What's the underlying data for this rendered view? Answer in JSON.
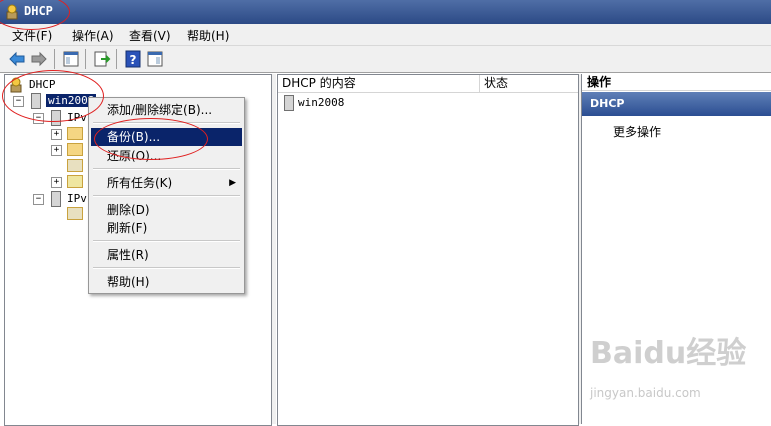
{
  "window": {
    "title": "DHCP"
  },
  "menubar": [
    {
      "label": "文件(F)"
    },
    {
      "label": "操作(A)"
    },
    {
      "label": "查看(V)"
    },
    {
      "label": "帮助(H)"
    }
  ],
  "toolbar": {
    "buttons": [
      "back-arrow-icon",
      "forward-arrow-icon",
      "show-hide-tree-icon",
      "export-list-icon",
      "help-icon",
      "properties-icon"
    ]
  },
  "tree": {
    "root": "DHCP",
    "server": "win2008",
    "ipv4_partial": "IPv",
    "ipv6_partial": "IPv"
  },
  "content": {
    "headers": [
      "DHCP 的内容",
      "状态"
    ],
    "rows": [
      {
        "name": "win2008",
        "status": ""
      }
    ]
  },
  "context_menu": {
    "items": [
      {
        "label": "添加/删除绑定(B)..."
      },
      {
        "label": "备份(B)..."
      },
      {
        "label": "还原(O)..."
      },
      {
        "label": "所有任务(K)"
      },
      {
        "label": "删除(D)"
      },
      {
        "label": "刷新(F)"
      },
      {
        "label": "属性(R)"
      },
      {
        "label": "帮助(H)"
      }
    ],
    "highlighted": "备份(B)..."
  },
  "actions": {
    "header": "操作",
    "group": "DHCP",
    "items": [
      "更多操作"
    ]
  },
  "watermark": {
    "brand": "Baidu经验",
    "url": "jingyan.baidu.com"
  },
  "colors": {
    "title_bar": "#2c4a86",
    "highlight": "#0a246a",
    "annotation": "#e02020"
  }
}
